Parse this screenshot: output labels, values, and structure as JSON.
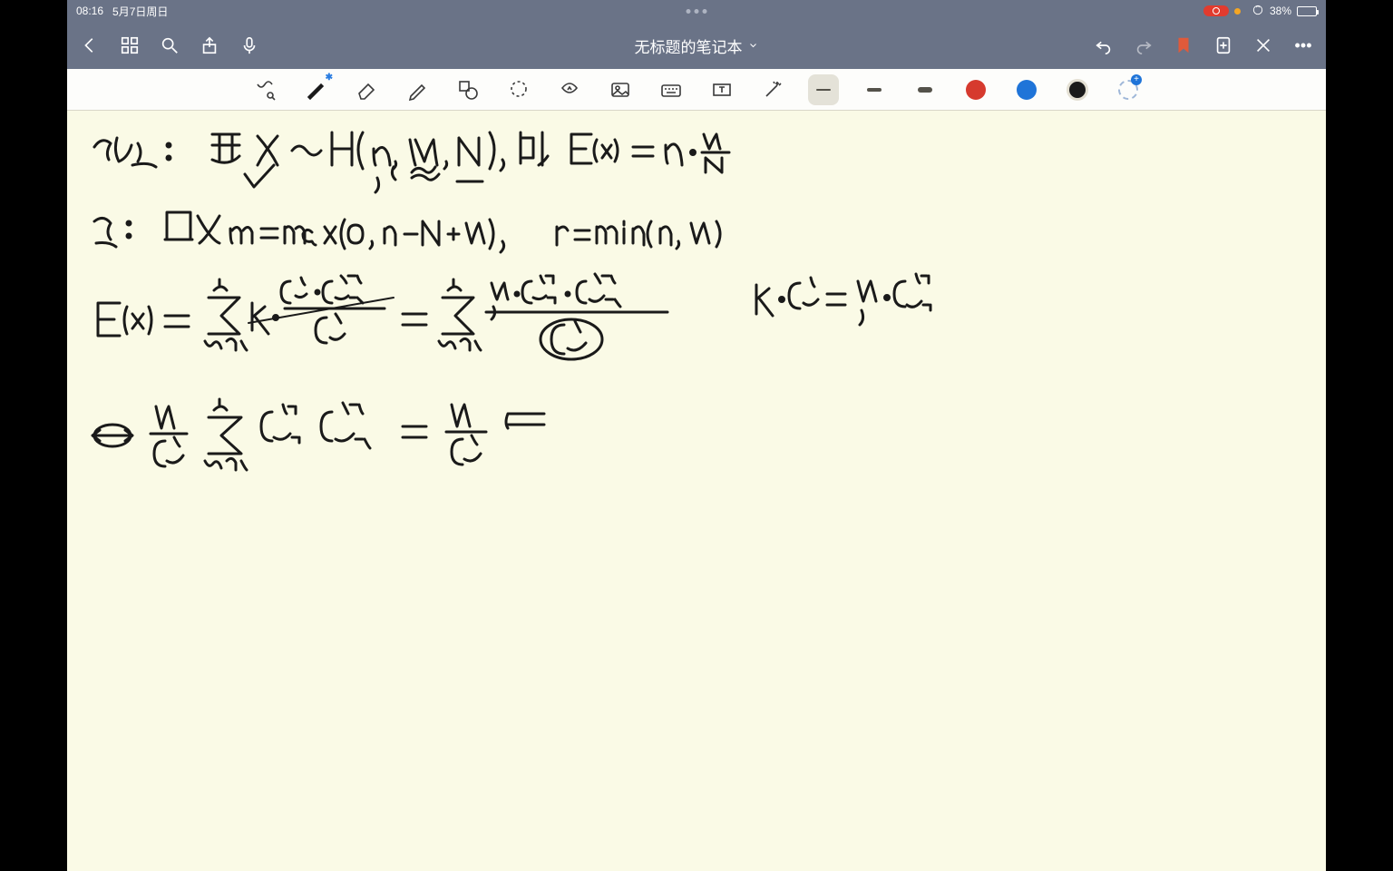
{
  "status": {
    "time": "08:16",
    "date": "5月7日周日",
    "battery_pct": "38%"
  },
  "nav": {
    "title": "无标题的笔记本"
  },
  "toolbar": {
    "zoom_label": "zoom-to-fit",
    "tools": [
      "pen",
      "eraser",
      "highlighter",
      "shape",
      "lasso",
      "sticker",
      "image",
      "keyboard",
      "text",
      "laser"
    ],
    "strokes": [
      "thin",
      "medium",
      "thick"
    ],
    "selected_stroke": "thin",
    "colors": [
      "#d63a2e",
      "#1f74d8",
      "#1b1b1b"
    ],
    "selected_color": "#1b1b1b"
  },
  "handwriting": {
    "line1": "命题:  若 X ~ H(n, M, N), 则 E(x) = n · M / N",
    "note1": "记:  取 m = max(0, n − N + M),  r = min(n, M)",
    "eq1": "E(x) = Σ_{k=m}^{r} k · C(M,k)·C(N−M,n−k) / C(N,n) = Σ_{k=m}^{r} M · C(M−1,k−1)·C(N−M,n−k) / C(N,n)",
    "identity": "k · C(M,k) = M · C(M−1,k−1)",
    "eq2": "⇔ (M / C(N,n)) · Σ_{k=m}^{r} C(M−1,k−1)·C(N−M,n−k) = (M / C(N,n)) · Σ …"
  }
}
